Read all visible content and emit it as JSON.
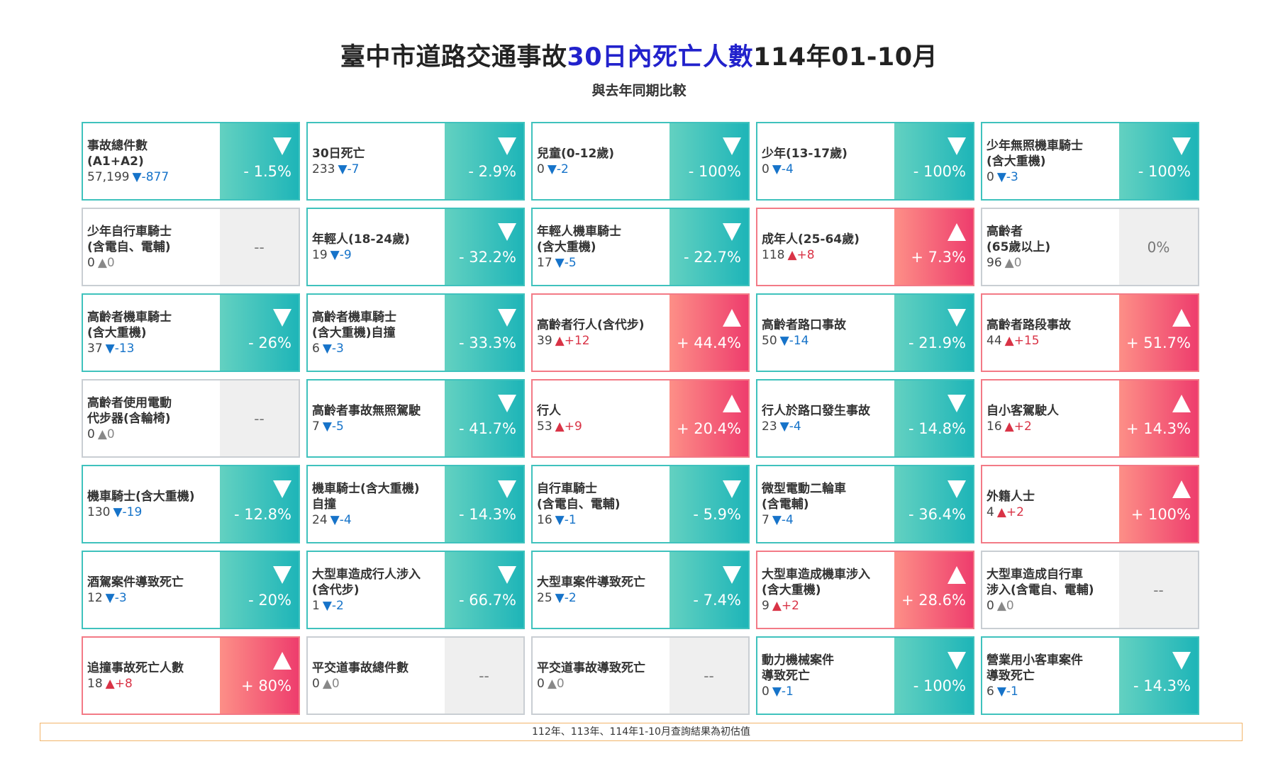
{
  "header": {
    "title_pre": "臺中市道路交通事故",
    "title_accent": "30日內死亡人數",
    "title_post": "114年01-10月",
    "subtitle": "與去年同期比較"
  },
  "colors": {
    "down_border": "#3fc2bd",
    "up_border": "#f37a86",
    "neutral_border": "#c9ced3",
    "down_text": "#1673c9",
    "up_text": "#d93346"
  },
  "cards": [
    {
      "name": "事故總件數\n(A1+A2)",
      "count": "57,199",
      "delta": "▼-877",
      "pct": "- 1.5%",
      "trend": "down"
    },
    {
      "name": "30日死亡",
      "count": "233",
      "delta": "▼-7",
      "pct": "- 2.9%",
      "trend": "down"
    },
    {
      "name": "兒童(0-12歲)",
      "count": "0",
      "delta": "▼-2",
      "pct": "- 100%",
      "trend": "down"
    },
    {
      "name": "少年(13-17歲)",
      "count": "0",
      "delta": "▼-4",
      "pct": "- 100%",
      "trend": "down"
    },
    {
      "name": "少年無照機車騎士\n(含大重機)",
      "count": "0",
      "delta": "▼-3",
      "pct": "- 100%",
      "trend": "down"
    },
    {
      "name": "少年自行車騎士\n(含電自、電輔)",
      "count": "0",
      "delta": "▲0",
      "pct": "--",
      "trend": "neutral"
    },
    {
      "name": "年輕人(18-24歲)",
      "count": "19",
      "delta": "▼-9",
      "pct": "- 32.2%",
      "trend": "down"
    },
    {
      "name": "年輕人機車騎士\n(含大重機)",
      "count": "17",
      "delta": "▼-5",
      "pct": "- 22.7%",
      "trend": "down"
    },
    {
      "name": "成年人(25-64歲)",
      "count": "118",
      "delta": "▲+8",
      "pct": "+ 7.3%",
      "trend": "up"
    },
    {
      "name": "高齡者\n(65歲以上)",
      "count": "96",
      "delta": "▲0",
      "pct": "0%",
      "trend": "neutral"
    },
    {
      "name": "高齡者機車騎士\n(含大重機)",
      "count": "37",
      "delta": "▼-13",
      "pct": "- 26%",
      "trend": "down"
    },
    {
      "name": "高齡者機車騎士\n(含大重機)自撞",
      "count": "6",
      "delta": "▼-3",
      "pct": "- 33.3%",
      "trend": "down"
    },
    {
      "name": "高齡者行人(含代步)",
      "count": "39",
      "delta": "▲+12",
      "pct": "+ 44.4%",
      "trend": "up"
    },
    {
      "name": "高齡者路口事故",
      "count": "50",
      "delta": "▼-14",
      "pct": "- 21.9%",
      "trend": "down"
    },
    {
      "name": "高齡者路段事故",
      "count": "44",
      "delta": "▲+15",
      "pct": "+ 51.7%",
      "trend": "up"
    },
    {
      "name": "高齡者使用電動\n代步器(含輪椅)",
      "count": "0",
      "delta": "▲0",
      "pct": "--",
      "trend": "neutral"
    },
    {
      "name": "高齡者事故無照駕駛",
      "count": "7",
      "delta": "▼-5",
      "pct": "- 41.7%",
      "trend": "down"
    },
    {
      "name": "行人",
      "count": "53",
      "delta": "▲+9",
      "pct": "+ 20.4%",
      "trend": "up"
    },
    {
      "name": "行人於路口發生事故",
      "count": "23",
      "delta": "▼-4",
      "pct": "- 14.8%",
      "trend": "down"
    },
    {
      "name": "自小客駕駛人",
      "count": "16",
      "delta": "▲+2",
      "pct": "+ 14.3%",
      "trend": "up"
    },
    {
      "name": "機車騎士(含大重機)",
      "count": "130",
      "delta": "▼-19",
      "pct": "- 12.8%",
      "trend": "down"
    },
    {
      "name": "機車騎士(含大重機)\n自撞",
      "count": "24",
      "delta": "▼-4",
      "pct": "- 14.3%",
      "trend": "down"
    },
    {
      "name": "自行車騎士\n(含電自、電輔)",
      "count": "16",
      "delta": "▼-1",
      "pct": "- 5.9%",
      "trend": "down"
    },
    {
      "name": "微型電動二輪車\n(含電輔)",
      "count": "7",
      "delta": "▼-4",
      "pct": "- 36.4%",
      "trend": "down"
    },
    {
      "name": "外籍人士",
      "count": "4",
      "delta": "▲+2",
      "pct": "+ 100%",
      "trend": "up"
    },
    {
      "name": "酒駕案件導致死亡",
      "count": "12",
      "delta": "▼-3",
      "pct": "- 20%",
      "trend": "down"
    },
    {
      "name": "大型車造成行人涉入\n(含代步)",
      "count": "1",
      "delta": "▼-2",
      "pct": "- 66.7%",
      "trend": "down"
    },
    {
      "name": "大型車案件導致死亡",
      "count": "25",
      "delta": "▼-2",
      "pct": "- 7.4%",
      "trend": "down"
    },
    {
      "name": "大型車造成機車涉入\n(含大重機)",
      "count": "9",
      "delta": "▲+2",
      "pct": "+ 28.6%",
      "trend": "up"
    },
    {
      "name": "大型車造成自行車\n涉入(含電自、電輔)",
      "count": "0",
      "delta": "▲0",
      "pct": "--",
      "trend": "neutral"
    },
    {
      "name": "追撞事故死亡人數",
      "count": "18",
      "delta": "▲+8",
      "pct": "+ 80%",
      "trend": "up"
    },
    {
      "name": "平交道事故總件數",
      "count": "0",
      "delta": "▲0",
      "pct": "--",
      "trend": "neutral"
    },
    {
      "name": "平交道事故導致死亡",
      "count": "0",
      "delta": "▲0",
      "pct": "--",
      "trend": "neutral"
    },
    {
      "name": "動力機械案件\n導致死亡",
      "count": "0",
      "delta": "▼-1",
      "pct": "- 100%",
      "trend": "down"
    },
    {
      "name": "營業用小客車案件\n導致死亡",
      "count": "6",
      "delta": "▼-1",
      "pct": "- 14.3%",
      "trend": "down"
    }
  ],
  "footer": {
    "note": "112年、113年、114年1-10月查詢結果為初估值"
  }
}
